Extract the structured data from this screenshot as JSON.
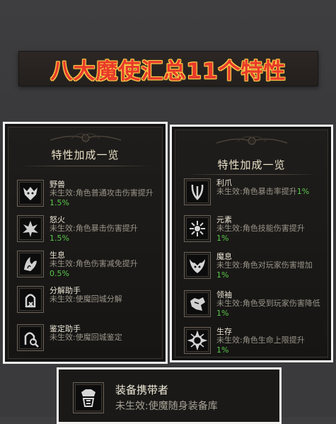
{
  "banner": {
    "title": "八大魔使汇总11个特性"
  },
  "left_panel": {
    "title": "特性加成一览",
    "rows": [
      {
        "name": "野兽",
        "desc": "未生效:角色普通攻击伤害提升",
        "pct": "1.5%",
        "icon": "beast-icon"
      },
      {
        "name": "怒火",
        "desc": "未生效:角色暴击伤害提升",
        "pct": "1.5%",
        "icon": "fury-icon"
      },
      {
        "name": "生息",
        "desc": "未生效:角色伤害减免提升",
        "pct": "0.5%",
        "icon": "breath-icon"
      },
      {
        "name": "分解助手",
        "desc": "未生效:使魔回城分解",
        "pct": "",
        "icon": "dismantle-icon"
      },
      {
        "name": "鉴定助手",
        "desc": "未生效:使魔回城鉴定",
        "pct": "",
        "icon": "identify-icon"
      }
    ]
  },
  "right_panel": {
    "title": "特性加成一览",
    "rows": [
      {
        "name": "利爪",
        "desc": "未生效:角色暴击率提升",
        "pct": "1%",
        "icon": "claw-icon"
      },
      {
        "name": "元素",
        "desc": "未生效:角色技能伤害提升",
        "pct": "1%",
        "icon": "element-icon"
      },
      {
        "name": "魔息",
        "desc": "未生效:角色对玩家伤害增加",
        "pct": "1%",
        "icon": "demon-breath-icon"
      },
      {
        "name": "领袖",
        "desc": "未生效:角色受到玩家伤害降低",
        "pct": "1%",
        "icon": "leader-icon"
      },
      {
        "name": "生存",
        "desc": "未生效:角色生命上限提升",
        "pct": "1%",
        "icon": "survival-icon"
      }
    ]
  },
  "bottom_panel": {
    "name": "装备携带者",
    "desc": "未生效:使魔随身装备库",
    "icon": "equipment-carrier-icon"
  },
  "colors": {
    "banner_text": "#e83a2a",
    "banner_outline": "#ffcf4a",
    "percent": "#58c84a"
  }
}
